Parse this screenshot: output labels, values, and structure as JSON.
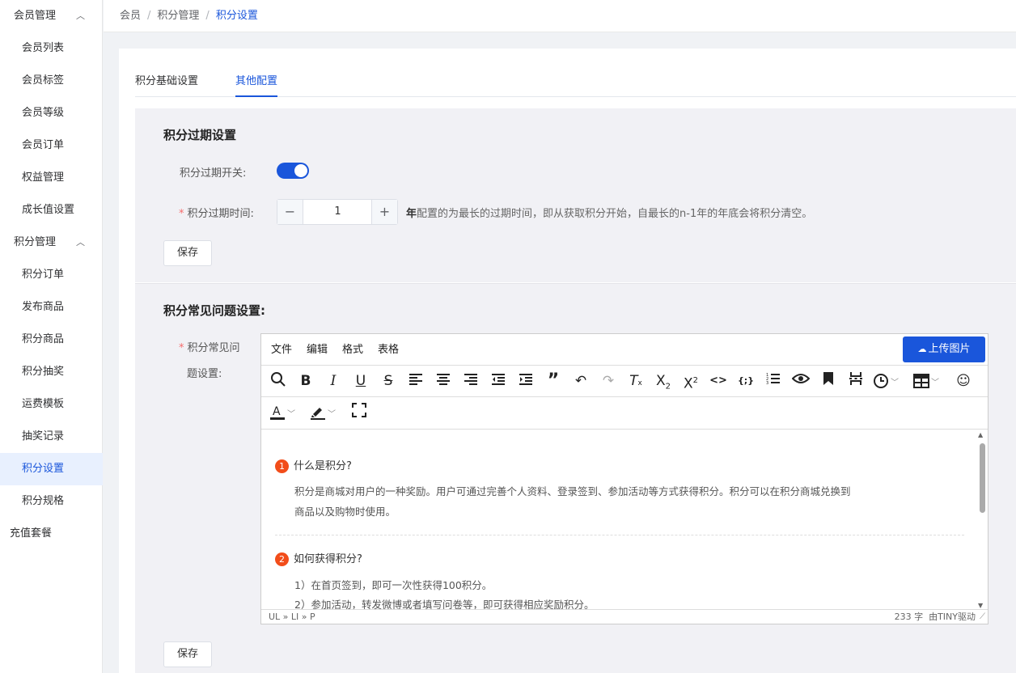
{
  "sidebar": {
    "group1": {
      "label": "会员管理",
      "caret": "^"
    },
    "group1_items": [
      "会员列表",
      "会员标签",
      "会员等级",
      "会员订单",
      "权益管理",
      "成长值设置"
    ],
    "group2": {
      "label": "积分管理",
      "caret": "^"
    },
    "group2_items": [
      "积分订单",
      "发布商品",
      "积分商品",
      "积分抽奖",
      "运费模板",
      "抽奖记录",
      "积分设置",
      "积分规格"
    ],
    "active_item": "积分设置",
    "top_item": "充值套餐"
  },
  "breadcrumb": {
    "items": [
      "会员",
      "积分管理",
      "积分设置"
    ],
    "separator": "/"
  },
  "tabs": {
    "items": [
      "积分基础设置",
      "其他配置"
    ],
    "active": "其他配置"
  },
  "expire_panel": {
    "title": "积分过期设置",
    "switch_label": "积分过期开关:",
    "switch_on": true,
    "time_label": "积分过期时间:",
    "required_mark": "*",
    "stepper": {
      "minus": "−",
      "value": "1",
      "plus": "+"
    },
    "unit": "年",
    "hint": "配置的为最长的过期时间，即从获取积分开始，自最长的n-1年的年底会将积分清空。",
    "save_label": "保存"
  },
  "faq_panel": {
    "title": "积分常见问题设置:",
    "label_line1": "积分常见问",
    "label_line2": "题设置:",
    "required_mark": "*",
    "save_label": "保存"
  },
  "editor": {
    "menus": [
      "文件",
      "编辑",
      "格式",
      "表格"
    ],
    "upload_label": "上传图片",
    "toolbar_icons": [
      "search-icon",
      "bold-icon",
      "italic-icon",
      "underline-icon",
      "strikethrough-icon",
      "align-left-icon",
      "align-center-icon",
      "align-right-icon",
      "outdent-icon",
      "indent-icon",
      "blockquote-icon",
      "undo-icon",
      "redo-icon",
      "remove-format-icon",
      "subscript-icon",
      "superscript-icon",
      "code-icon",
      "code-sample-icon",
      "numbered-list-icon",
      "preview-icon",
      "bookmark-icon",
      "page-break-icon",
      "clock-icon",
      "table-icon",
      "emoji-icon",
      "text-color-icon",
      "highlight-color-icon",
      "fullscreen-icon"
    ],
    "faq": [
      {
        "num": "1",
        "question": "什么是积分?",
        "answer_line1": "积分是商城对用户的一种奖励。用户可通过完善个人资料、登录签到、参加活动等方式获得积分。积分可以在积分商城兑换到",
        "answer_line2": "商品以及购物时使用。"
      },
      {
        "num": "2",
        "question": "如何获得积分?",
        "answer_line1": "1）在首页签到，即可一次性获得100积分。",
        "answer_line2": "2）参加活动，转发微博或者填写问卷等，即可获得相应奖励积分。"
      }
    ],
    "status_path": "UL » LI » P",
    "word_count": "233 字",
    "powered_by": "由TINY驱动"
  },
  "colors": {
    "accent": "#1a56db",
    "number_badge": "#f24d1a",
    "panel_bg": "#f1f1f5"
  }
}
